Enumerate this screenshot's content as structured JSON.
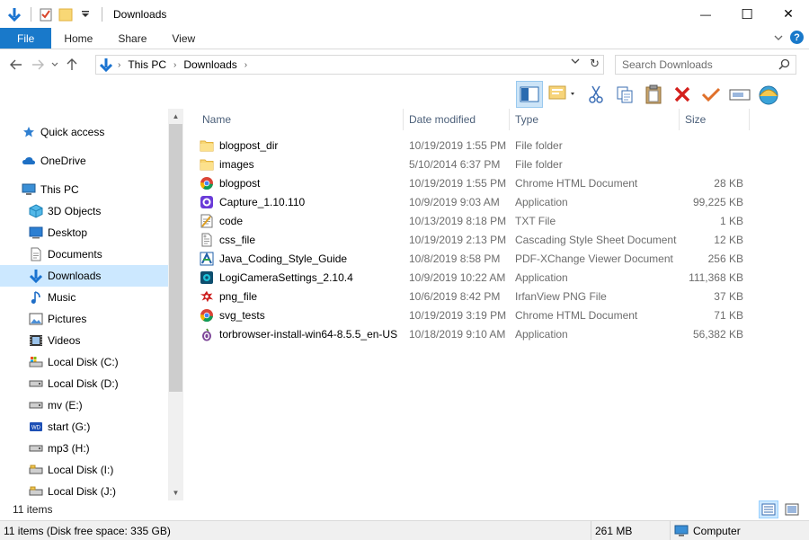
{
  "window": {
    "title": "Downloads",
    "minimize_glyph": "—",
    "maximize_glyph": "☐",
    "close_glyph": "✕"
  },
  "ribbon": {
    "tabs": [
      "File",
      "Home",
      "Share",
      "View"
    ],
    "help_glyph": "?"
  },
  "address": {
    "crumbs": [
      "This PC",
      "Downloads"
    ]
  },
  "search": {
    "placeholder": "Search Downloads"
  },
  "toolbar": {
    "icons": [
      "preview-pane-icon",
      "properties-icon",
      "cut-icon",
      "copy-icon",
      "paste-icon",
      "delete-icon",
      "check-icon",
      "rename-icon",
      "shell-icon"
    ]
  },
  "nav": {
    "items": [
      {
        "label": "Quick access",
        "icon": "star-icon",
        "indent": 1
      },
      {
        "label": "OneDrive",
        "icon": "cloud-icon",
        "indent": 1
      },
      {
        "label": "This PC",
        "icon": "computer-icon",
        "indent": 1
      },
      {
        "label": "3D Objects",
        "icon": "cube-icon",
        "indent": 2
      },
      {
        "label": "Desktop",
        "icon": "desktop-icon",
        "indent": 2
      },
      {
        "label": "Documents",
        "icon": "document-icon",
        "indent": 2
      },
      {
        "label": "Downloads",
        "icon": "download-icon",
        "indent": 2,
        "selected": true
      },
      {
        "label": "Music",
        "icon": "music-icon",
        "indent": 2
      },
      {
        "label": "Pictures",
        "icon": "picture-icon",
        "indent": 2
      },
      {
        "label": "Videos",
        "icon": "video-icon",
        "indent": 2
      },
      {
        "label": "Local Disk (C:)",
        "icon": "system-drive-icon",
        "indent": 2
      },
      {
        "label": "Local Disk (D:)",
        "icon": "drive-icon",
        "indent": 2
      },
      {
        "label": "mv (E:)",
        "icon": "drive-icon",
        "indent": 2
      },
      {
        "label": "start (G:)",
        "icon": "usb-drive-icon",
        "indent": 2
      },
      {
        "label": "mp3 (H:)",
        "icon": "drive-icon",
        "indent": 2
      },
      {
        "label": "Local Disk (I:)",
        "icon": "removable-drive-icon",
        "indent": 2
      },
      {
        "label": "Local Disk (J:)",
        "icon": "removable-drive-icon",
        "indent": 2
      }
    ]
  },
  "columns": {
    "name": "Name",
    "date": "Date modified",
    "type": "Type",
    "size": "Size"
  },
  "files": [
    {
      "name": "blogpost_dir",
      "date": "10/19/2019 1:55 PM",
      "type": "File folder",
      "size": "",
      "icon": "folder-icon"
    },
    {
      "name": "images",
      "date": "5/10/2014 6:37 PM",
      "type": "File folder",
      "size": "",
      "icon": "folder-icon"
    },
    {
      "name": "blogpost",
      "date": "10/19/2019 1:55 PM",
      "type": "Chrome HTML Document",
      "size": "28 KB",
      "icon": "chrome-icon"
    },
    {
      "name": "Capture_1.10.110",
      "date": "10/9/2019 9:03 AM",
      "type": "Application",
      "size": "99,225 KB",
      "icon": "capture-app-icon"
    },
    {
      "name": "code",
      "date": "10/13/2019 8:18 PM",
      "type": "TXT File",
      "size": "1 KB",
      "icon": "text-file-icon"
    },
    {
      "name": "css_file",
      "date": "10/19/2019 2:13 PM",
      "type": "Cascading Style Sheet Document",
      "size": "12 KB",
      "icon": "css-file-icon"
    },
    {
      "name": "Java_Coding_Style_Guide",
      "date": "10/8/2019 8:58 PM",
      "type": "PDF-XChange Viewer Document",
      "size": "256 KB",
      "icon": "pdf-icon"
    },
    {
      "name": "LogiCameraSettings_2.10.4",
      "date": "10/9/2019 10:22 AM",
      "type": "Application",
      "size": "111,368 KB",
      "icon": "logi-app-icon"
    },
    {
      "name": "png_file",
      "date": "10/6/2019 8:42 PM",
      "type": "IrfanView PNG File",
      "size": "37 KB",
      "icon": "irfanview-icon"
    },
    {
      "name": "svg_tests",
      "date": "10/19/2019 3:19 PM",
      "type": "Chrome HTML Document",
      "size": "71 KB",
      "icon": "chrome-icon"
    },
    {
      "name": "torbrowser-install-win64-8.5.5_en-US",
      "date": "10/18/2019 9:10 AM",
      "type": "Application",
      "size": "56,382 KB",
      "icon": "tor-icon"
    }
  ],
  "status": {
    "item_count": "11 items",
    "disk_info": "11 items (Disk free space: 335 GB)",
    "size_total": "261 MB",
    "location": "Computer"
  }
}
